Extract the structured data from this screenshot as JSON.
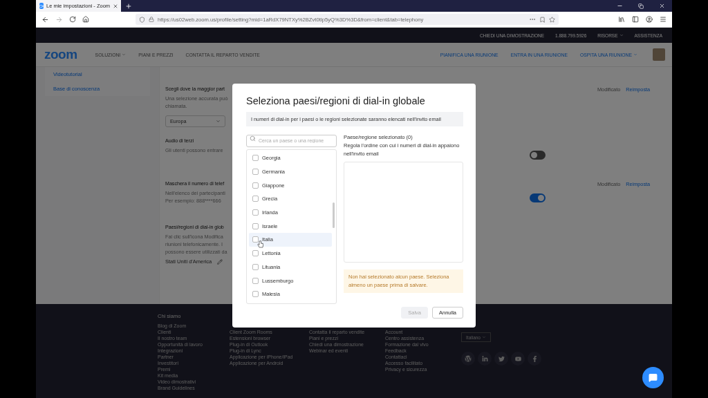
{
  "browser": {
    "tab_title": "Le mie impostazioni - Zoom",
    "url": "https://us02web.zoom.us/profile/setting?mid=1aRdX79NTXy%2BZvt0tIp5yQ%3D%3D&from=client&tab=telephony"
  },
  "topbar": [
    {
      "label": "CHIEDI UNA DIMOSTRAZIONE",
      "dropdown": false
    },
    {
      "label": "1.888.799.5926",
      "dropdown": false
    },
    {
      "label": "RISORSE",
      "dropdown": true
    },
    {
      "label": "ASSISTENZA",
      "dropdown": false
    }
  ],
  "nav": {
    "logo": "zoom",
    "left": [
      {
        "label": "SOLUZIONI",
        "dropdown": true
      },
      {
        "label": "PIANI E PREZZI",
        "dropdown": false
      },
      {
        "label": "CONTATTA IL REPARTO VENDITE",
        "dropdown": false
      }
    ],
    "right": [
      {
        "label": "PIANIFICA UNA RIUNIONE",
        "dropdown": false
      },
      {
        "label": "ENTRA IN UNA RIUNIONE",
        "dropdown": false
      },
      {
        "label": "OSPITA UNA RIUNIONE",
        "dropdown": true
      }
    ]
  },
  "sidebar": [
    "Videotutorial",
    "Base di conoscenza"
  ],
  "settings": [
    {
      "kind": "select",
      "title": "Scegli dove la maggior part",
      "description": "Una selezione accurata può chiamata.",
      "value": "Europa",
      "status": "Modificato",
      "reset": "Reimposta"
    },
    {
      "kind": "toggle",
      "title": "Audio di terzi",
      "description": "Gli utenti possono entrare",
      "on": false
    },
    {
      "kind": "toggle",
      "title": "Maschera il numero di telef",
      "description": "Nell'elenco dei partecipanti Per esempio: 888****666",
      "on": true,
      "status": "Modificato",
      "reset": "Reimposta"
    },
    {
      "kind": "countries",
      "title": "Paesi/regioni di dial-in glob",
      "description": "Fai clic sull'icona Modifica riunioni telefonicamente. I possono essere utilizzati da",
      "value": "Stati Uniti d'America"
    }
  ],
  "modal": {
    "title": "Seleziona paesi/regioni di dial-in globale",
    "info": "I numeri di dial-in per i paesi o le regioni selezionate saranno elencati nell'invito email",
    "search_placeholder": "Cerca un paese o una regione",
    "countries": [
      {
        "name": "Georgia",
        "checked": false,
        "highlighted": false
      },
      {
        "name": "Germania",
        "checked": false,
        "highlighted": false
      },
      {
        "name": "Giappone",
        "checked": false,
        "highlighted": false
      },
      {
        "name": "Grecia",
        "checked": false,
        "highlighted": false
      },
      {
        "name": "Irlanda",
        "checked": false,
        "highlighted": false
      },
      {
        "name": "Israele",
        "checked": false,
        "highlighted": false
      },
      {
        "name": "Italia",
        "checked": false,
        "highlighted": true
      },
      {
        "name": "Lettonia",
        "checked": false,
        "highlighted": false
      },
      {
        "name": "Lituania",
        "checked": false,
        "highlighted": false
      },
      {
        "name": "Lussemburgo",
        "checked": false,
        "highlighted": false
      },
      {
        "name": "Malesia",
        "checked": false,
        "highlighted": false
      }
    ],
    "selected_heading": "Paese/regione selezionato (0)",
    "selected_hint": "Regola l'ordine con cui i numeri di dial-in appaiono nell'invito email",
    "warning": "Non hai selezionato alcun paese. Seleziona almeno un paese prima di salvare.",
    "buttons": [
      {
        "label": "Salva",
        "disabled": true
      },
      {
        "label": "Annulla",
        "disabled": false
      }
    ]
  },
  "footer": {
    "columns": [
      {
        "header": "Chi siamo",
        "items": [
          "Blog di Zoom",
          "Clienti",
          "Il nostro team",
          "Opportunità di lavoro",
          "Integrazioni",
          "Partner",
          "Investitori",
          "Premi",
          "Kit media",
          "Video dimostrativi",
          "Brand Guidelines"
        ]
      },
      {
        "items": [
          "Client Zoom Rooms",
          "Estensioni browser",
          "Plug-in di Outlook",
          "Plug-in di Lync",
          "Applicazione per iPhone/iPad",
          "Applicazione per Android"
        ]
      },
      {
        "items": [
          "Contatta il reparto vendite",
          "Piani e prezzi",
          "Chiedi una dimostrazione",
          "Webinar ed eventi"
        ]
      },
      {
        "items": [
          "Account",
          "Centro assistenza",
          "Formazione dal vivo",
          "Feedback",
          "Contattaci",
          "Accesso facilitato",
          "Privacy e sicurezza"
        ]
      }
    ],
    "language": "Italiano"
  }
}
